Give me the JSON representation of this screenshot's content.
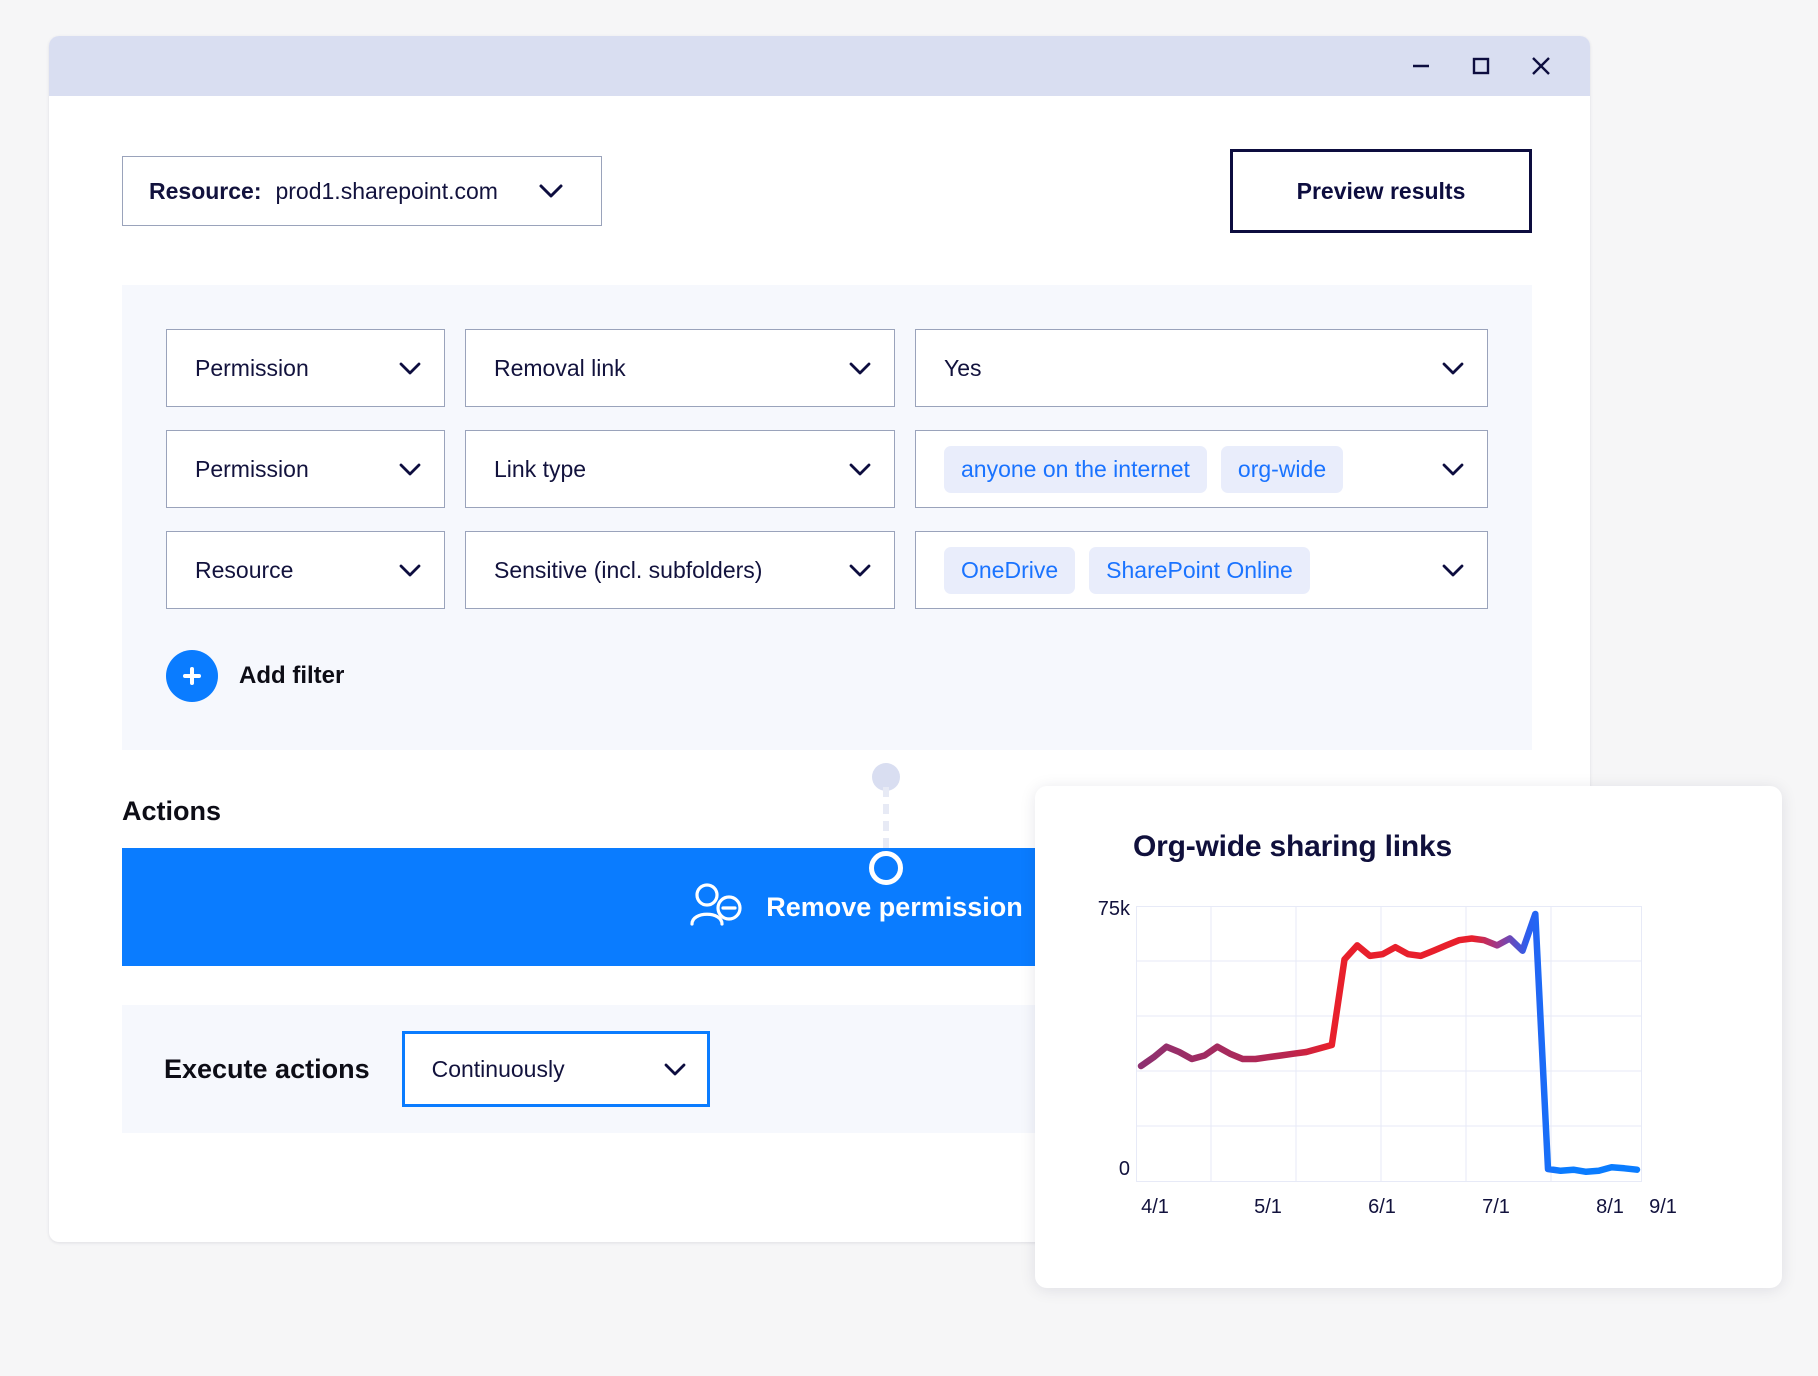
{
  "window": {
    "controls": [
      {
        "name": "minimize",
        "icon": "minimize-icon"
      },
      {
        "name": "maximize",
        "icon": "maximize-icon"
      },
      {
        "name": "close",
        "icon": "close-icon"
      }
    ]
  },
  "toolbar": {
    "resource_label": "Resource:",
    "resource_value": "prod1.sharepoint.com",
    "resource_chevron": "chevron-down-icon",
    "preview_button": "Preview results"
  },
  "filters": {
    "rows": [
      {
        "field": "Permission",
        "attribute": "Removal link",
        "value_text": "Yes",
        "value_tags": []
      },
      {
        "field": "Permission",
        "attribute": "Link type",
        "value_text": "",
        "value_tags": [
          "anyone on the internet",
          "org-wide"
        ]
      },
      {
        "field": "Resource",
        "attribute": "Sensitive (incl. subfolders)",
        "value_text": "",
        "value_tags": [
          "OneDrive",
          "SharePoint Online"
        ]
      }
    ],
    "add_filter_label": "Add filter",
    "add_filter_icon": "plus-icon"
  },
  "actions": {
    "section_title": "Actions",
    "action_label": "Remove permission",
    "action_icon": "user-minus-icon",
    "execute_label": "Execute actions",
    "execute_value": "Continuously"
  },
  "colors": {
    "accent_blue": "#0a7cff",
    "tag_blue": "#1a73ff",
    "tag_bg": "#e9edfb",
    "navy": "#0d0d3f",
    "panel_bg": "#f6f8fd",
    "titlebar_bg": "#d9def1",
    "line_start": "#8e3170",
    "line_mid": "#e8202c",
    "line_end": "#0a7cff"
  },
  "chart_data": {
    "type": "line",
    "title": "Org-wide sharing links",
    "xlabel": "",
    "ylabel": "",
    "ylim": [
      0,
      75000
    ],
    "y_ticks": [
      "0",
      "75k"
    ],
    "x_ticks": [
      "4/1",
      "5/1",
      "6/1",
      "7/1",
      "8/1",
      "9/1"
    ],
    "grid": true,
    "legend": "none",
    "series": [
      {
        "name": "Org-wide sharing links",
        "gradient": [
          "#8e3170",
          "#e8202c",
          "#0a7cff"
        ],
        "x": [
          "4/1",
          "4/4",
          "4/8",
          "4/12",
          "4/16",
          "4/20",
          "4/24",
          "4/28",
          "5/2",
          "5/6",
          "5/10",
          "5/14",
          "5/18",
          "5/22",
          "5/26",
          "5/30",
          "6/3",
          "6/7",
          "6/11",
          "6/15",
          "6/19",
          "6/23",
          "6/27",
          "7/1",
          "7/5",
          "7/9",
          "7/13",
          "7/17",
          "7/21",
          "7/25",
          "7/29",
          "8/2",
          "8/6",
          "8/10",
          "8/14",
          "8/18",
          "8/22",
          "8/26",
          "8/30",
          "9/1"
        ],
        "values": [
          31500,
          34000,
          37000,
          35500,
          33500,
          34500,
          37000,
          35000,
          33500,
          33500,
          34000,
          34500,
          35000,
          35500,
          36500,
          37500,
          62000,
          66000,
          63000,
          63500,
          65500,
          63500,
          63000,
          64500,
          66000,
          67500,
          68000,
          67500,
          66000,
          68000,
          64500,
          75000,
          2000,
          1500,
          1800,
          1200,
          1500,
          2500,
          2200,
          1800
        ]
      }
    ]
  }
}
